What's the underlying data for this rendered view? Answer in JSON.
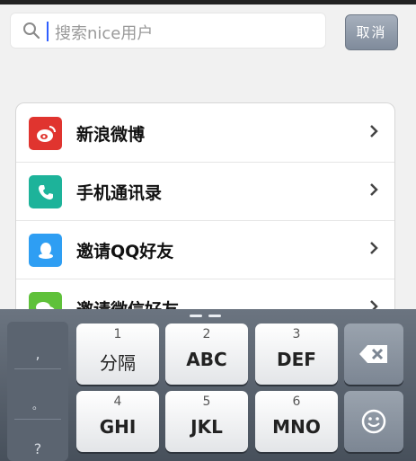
{
  "search": {
    "placeholder": "搜索nice用户",
    "cancel_label": "取消"
  },
  "list": {
    "items": [
      {
        "label": "新浪微博",
        "icon": "weibo-icon",
        "color": "#e0342f"
      },
      {
        "label": "手机通讯录",
        "icon": "phone-icon",
        "color": "#1db39a"
      },
      {
        "label": "邀请QQ好友",
        "icon": "qq-icon",
        "color": "#2e9ef3"
      },
      {
        "label": "邀请微信好友",
        "icon": "wechat-icon",
        "color": "#5fc13a"
      }
    ]
  },
  "keyboard": {
    "left_symbols": [
      ",",
      "。",
      "?"
    ],
    "keys": [
      {
        "num": "1",
        "letters": "分隔"
      },
      {
        "num": "2",
        "letters": "ABC"
      },
      {
        "num": "3",
        "letters": "DEF"
      },
      {
        "num": "4",
        "letters": "GHI"
      },
      {
        "num": "5",
        "letters": "JKL"
      },
      {
        "num": "6",
        "letters": "MNO"
      }
    ]
  }
}
